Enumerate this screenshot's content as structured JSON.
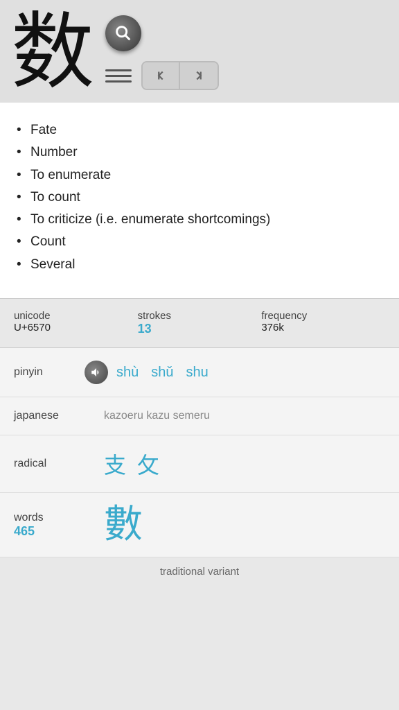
{
  "header": {
    "kanji": "数",
    "search_label": "search"
  },
  "nav": {
    "prev_label": "◀◀",
    "next_label": "▶▶",
    "menu_label": "menu"
  },
  "meanings": {
    "items": [
      "Fate",
      "Number",
      "To enumerate",
      "To count",
      "To criticize (i.e. enumerate shortcomings)",
      "Count",
      "Several"
    ]
  },
  "stats": {
    "unicode_label": "unicode",
    "unicode_value": "U+6570",
    "strokes_label": "strokes",
    "strokes_value": "13",
    "frequency_label": "frequency",
    "frequency_value": "376k"
  },
  "pinyin": {
    "label": "pinyin",
    "values": [
      "shù",
      "shǔ",
      "shu"
    ]
  },
  "japanese": {
    "label": "japanese",
    "value": "kazoeru kazu semeru"
  },
  "radical": {
    "label": "radical",
    "chars": [
      "支",
      "攵"
    ]
  },
  "words": {
    "label": "words",
    "count": "465",
    "kanji": "數"
  },
  "traditional": {
    "label": "traditional variant"
  }
}
